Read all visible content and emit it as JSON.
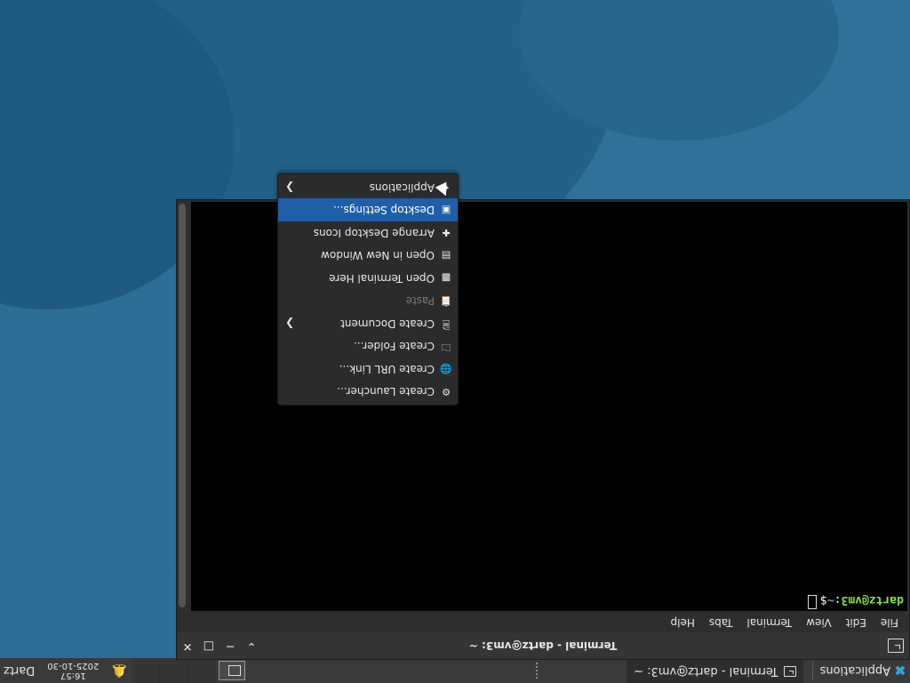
{
  "panel": {
    "applications_label": "Applications",
    "task": {
      "label": "Terminal - dartz@vm3: ~",
      "icon": "terminal-icon"
    },
    "clock": {
      "date": "2025-10-30",
      "time": "16:57"
    },
    "user": "Dartz"
  },
  "terminal": {
    "title": "Terminal - dartz@vm3: ~",
    "menu": [
      "File",
      "Edit",
      "View",
      "Terminal",
      "Tabs",
      "Help"
    ],
    "prompt": {
      "user_host": "dartz@vm3",
      "colon": ":",
      "path": "~",
      "dollar": "$"
    }
  },
  "context_menu": {
    "items": [
      {
        "label": "Create Launcher...",
        "icon": "launcher-icon",
        "submenu": false,
        "disabled": false,
        "highlighted": false
      },
      {
        "label": "Create URL Link...",
        "icon": "link-icon",
        "submenu": false,
        "disabled": false,
        "highlighted": false
      },
      {
        "label": "Create Folder...",
        "icon": "folder-icon",
        "submenu": false,
        "disabled": false,
        "highlighted": false
      },
      {
        "label": "Create Document",
        "icon": "document-icon",
        "submenu": true,
        "disabled": false,
        "highlighted": false
      },
      {
        "label": "Paste",
        "icon": "paste-icon",
        "submenu": false,
        "disabled": true,
        "highlighted": false
      },
      {
        "label": "Open Terminal Here",
        "icon": "terminal-icon",
        "submenu": false,
        "disabled": false,
        "highlighted": false
      },
      {
        "label": "Open in New Window",
        "icon": "window-icon",
        "submenu": false,
        "disabled": false,
        "highlighted": false
      },
      {
        "label": "Arrange Desktop Icons",
        "icon": "arrange-icon",
        "submenu": false,
        "disabled": false,
        "highlighted": false
      },
      {
        "label": "Desktop Settings...",
        "icon": "settings-icon",
        "submenu": false,
        "disabled": false,
        "highlighted": true
      },
      {
        "label": "Applications",
        "icon": "applications-icon",
        "submenu": true,
        "disabled": false,
        "highlighted": false
      }
    ]
  },
  "colors": {
    "desktop": "#2b6d94",
    "panel": "#3a3a3a",
    "highlight": "#1f5ea8",
    "prompt_user": "#8ae234",
    "prompt_path": "#729fcf"
  }
}
